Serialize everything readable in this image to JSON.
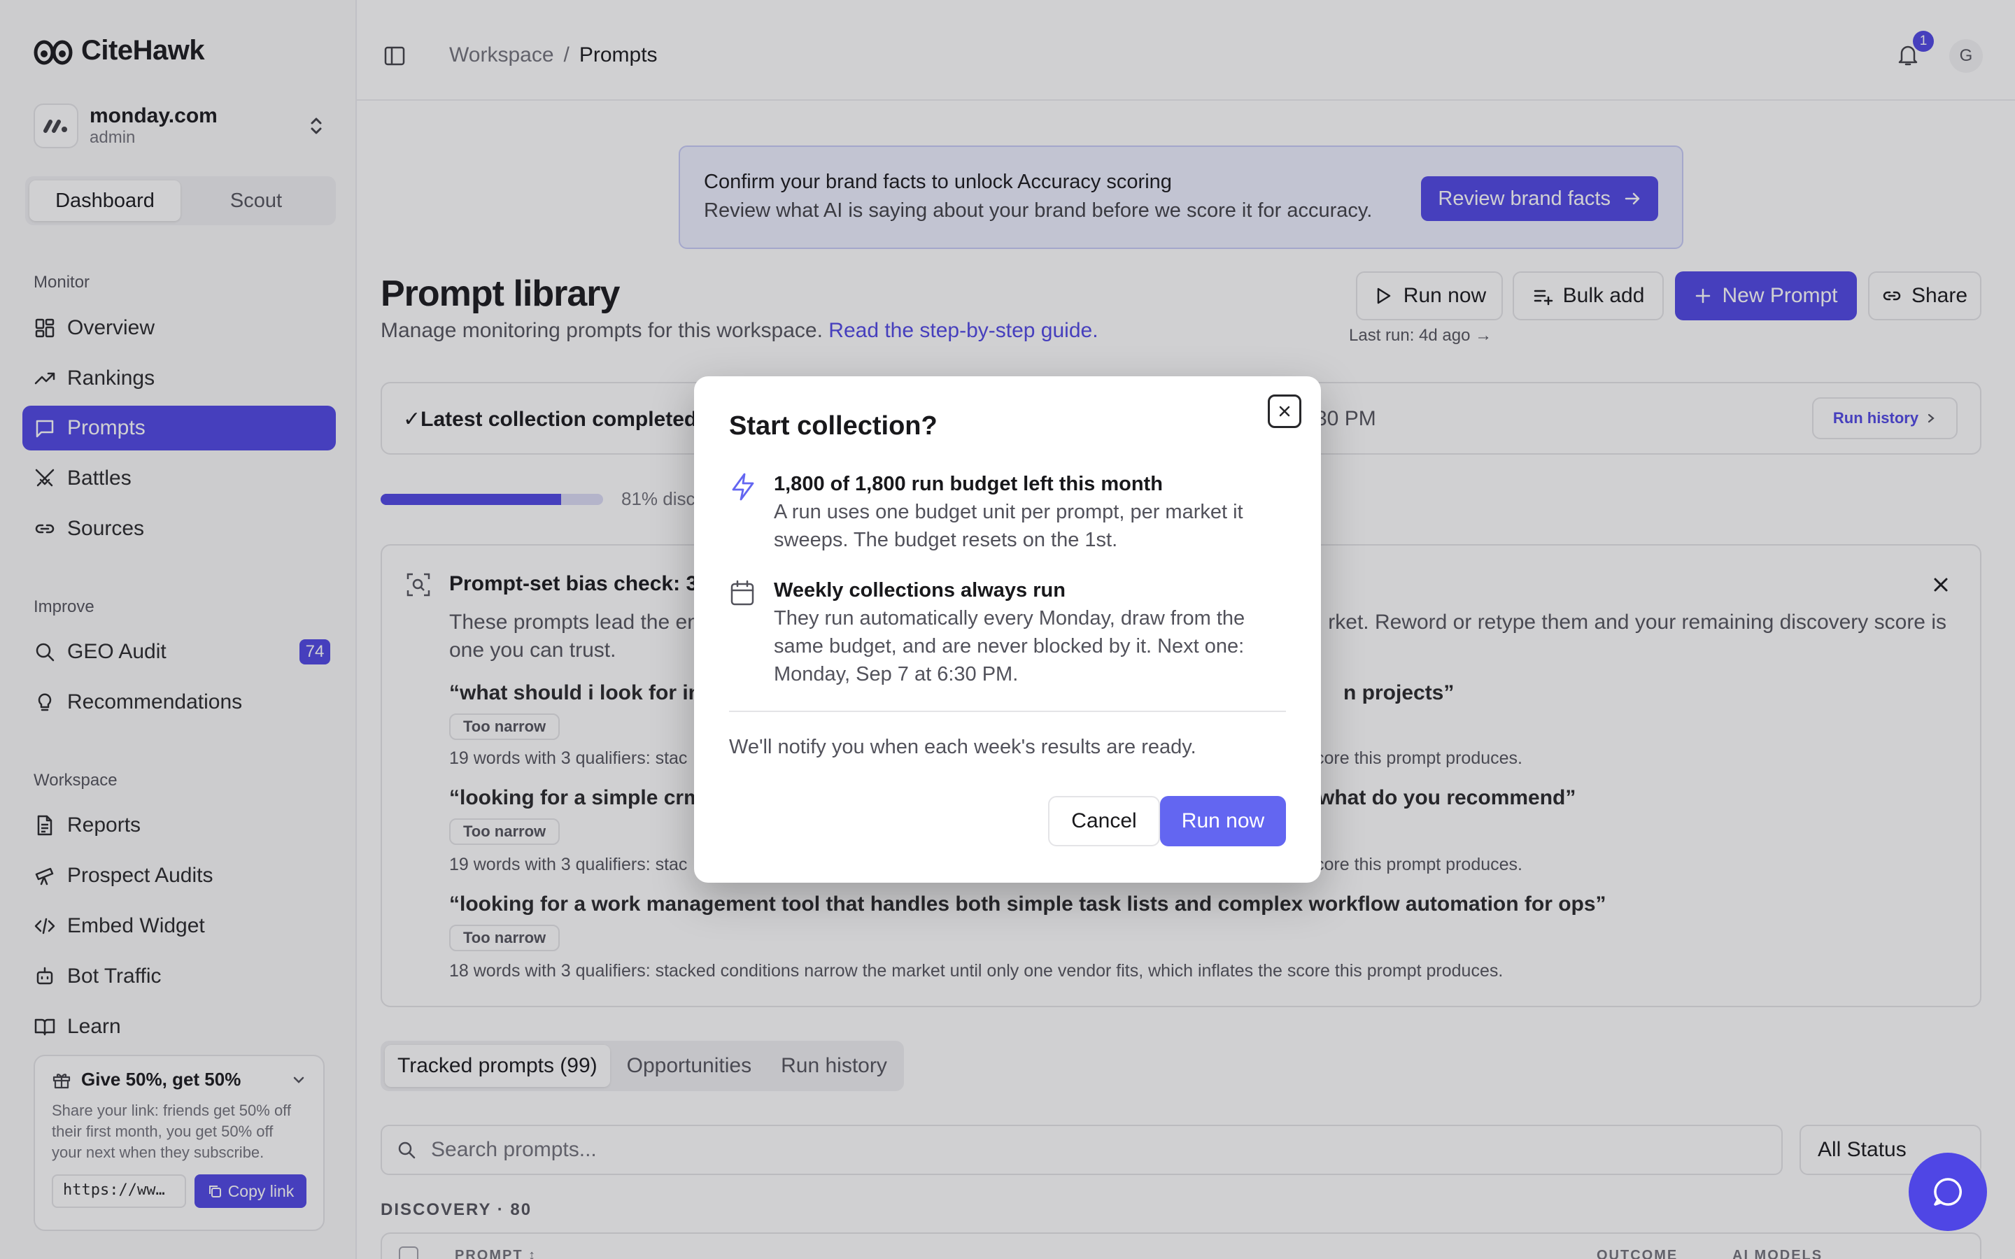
{
  "app": {
    "name": "CiteHawk"
  },
  "workspace": {
    "name": "monday.com",
    "role": "admin"
  },
  "mode_tabs": [
    "Dashboard",
    "Scout"
  ],
  "sidebar": {
    "monitor_label": "Monitor",
    "monitor": [
      "Overview",
      "Rankings",
      "Prompts",
      "Battles",
      "Sources"
    ],
    "improve_label": "Improve",
    "improve": [
      "GEO Audit",
      "Recommendations"
    ],
    "geo_badge": "74",
    "workspace_label": "Workspace",
    "workspace_items": [
      "Reports",
      "Prospect Audits",
      "Embed Widget",
      "Bot Traffic",
      "Learn"
    ]
  },
  "referral": {
    "title": "Give 50%, get 50%",
    "desc": "Share your link: friends get 50% off their first month, you get 50% off your next when they subscribe.",
    "url": "https://ww…",
    "copy_label": "Copy link"
  },
  "topbar": {
    "crumb_root": "Workspace",
    "crumb_sep": "/",
    "crumb_current": "Prompts",
    "notif_count": "1",
    "user_initial": "G"
  },
  "banner": {
    "title": "Confirm your brand facts to unlock Accuracy scoring",
    "body": "Review what AI is saying about your brand before we score it for accuracy.",
    "button": "Review brand facts"
  },
  "page": {
    "title": "Prompt library",
    "subtitle": "Manage monitoring prompts for this workspace.",
    "guide_link": "Read the step-by-step guide.",
    "run_now": "Run now",
    "bulk_add": "Bulk add",
    "new_prompt": "New Prompt",
    "share": "Share",
    "last_run": "Last run: 4d ago →"
  },
  "collection": {
    "text": "✓Latest collection completed M",
    "tail": "30 PM",
    "run_history": "Run history"
  },
  "progress": {
    "percent": 81,
    "label": "81% disc"
  },
  "bias": {
    "title": "Prompt-set bias check: 3 c",
    "desc_left": "These prompts lead the en",
    "desc_right": "rket. Reword or retype them and your remaining discovery score is",
    "desc_line2": "one you can trust.",
    "prompts": [
      {
        "left": "“what should i look for in a",
        "right": "n projects”",
        "tag": "Too narrow",
        "note_left": "19 words with 3 qualifiers: stac",
        "note_right": "core this prompt produces."
      },
      {
        "left": "“looking for a simple crm a",
        "right": "what do you recommend”",
        "tag": "Too narrow",
        "note_left": "19 words with 3 qualifiers: stac",
        "note_right": "core this prompt produces."
      },
      {
        "full": "“looking for a work management tool that handles both simple task lists and complex workflow automation for ops”",
        "tag": "Too narrow",
        "note": "18 words with 3 qualifiers: stacked conditions narrow the market until only one vendor fits, which inflates the score this prompt produces."
      }
    ]
  },
  "content_tabs": [
    "Tracked prompts (99)",
    "Opportunities",
    "Run history"
  ],
  "search": {
    "placeholder": "Search prompts..."
  },
  "status_filter": "All Status",
  "discovery_label": "DISCOVERY · 80",
  "table_headers": [
    "PROMPT ↕",
    "OUTCOME",
    "AI MODELS"
  ],
  "modal": {
    "title": "Start collection?",
    "budget_heading": "1,800 of 1,800 run budget left this month",
    "budget_body": "A run uses one budget unit per prompt, per market it sweeps. The budget resets on the 1st.",
    "weekly_heading": "Weekly collections always run",
    "weekly_body": "They run automatically every Monday, draw from the same budget, and are never blocked by it. Next one: Monday, Sep 7 at 6:30 PM.",
    "note": "We'll notify you when each week's results are ready.",
    "cancel": "Cancel",
    "run_now": "Run now"
  },
  "colors": {
    "accent": "#4f46e5",
    "modal_primary": "#6366f1"
  }
}
